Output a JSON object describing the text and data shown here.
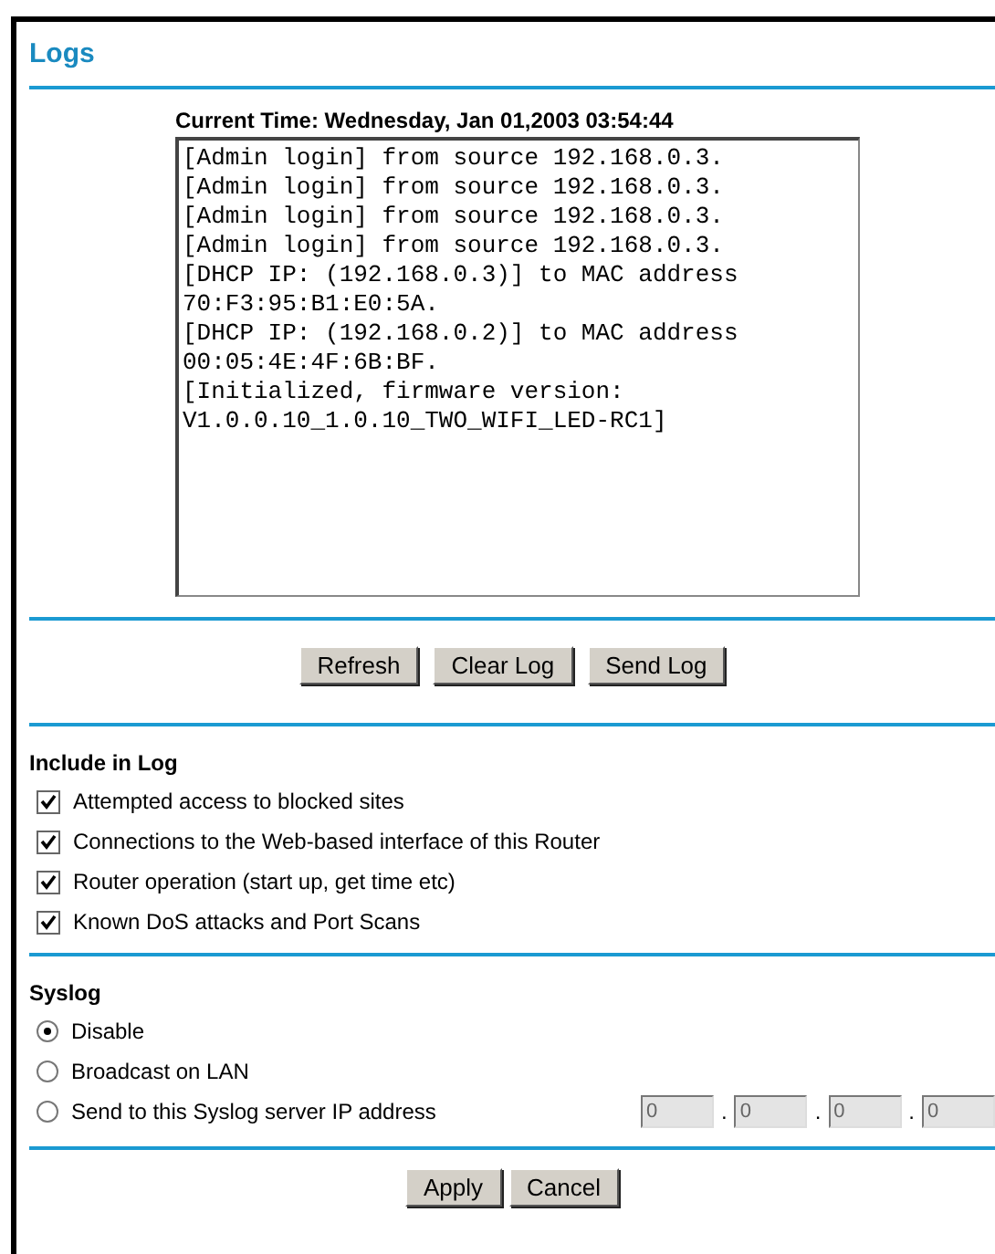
{
  "title": "Logs",
  "current_time": "Current Time: Wednesday, Jan 01,2003 03:54:44",
  "log_lines": [
    "[Admin login] from source 192.168.0.3.",
    "[Admin login] from source 192.168.0.3.",
    "[Admin login] from source 192.168.0.3.",
    "[Admin login] from source 192.168.0.3.",
    "[DHCP IP: (192.168.0.3)] to MAC address",
    "70:F3:95:B1:E0:5A.",
    "[DHCP IP: (192.168.0.2)] to MAC address",
    "00:05:4E:4F:6B:BF.",
    "[Initialized, firmware version:",
    "V1.0.0.10_1.0.10_TWO_WIFI_LED-RC1]"
  ],
  "log_buttons": [
    "Refresh",
    "Clear Log",
    "Send Log"
  ],
  "include_in_log": {
    "heading": "Include in Log",
    "items": [
      {
        "label": "Attempted access to blocked sites",
        "checked": true
      },
      {
        "label": "Connections to the Web-based interface of this Router",
        "checked": true
      },
      {
        "label": "Router operation (start up, get time etc)",
        "checked": true
      },
      {
        "label": "Known DoS attacks and Port Scans",
        "checked": true
      }
    ]
  },
  "syslog": {
    "heading": "Syslog",
    "options": [
      {
        "label": "Disable",
        "selected": true
      },
      {
        "label": "Broadcast on LAN",
        "selected": false
      },
      {
        "label": "Send to this Syslog server IP address",
        "selected": false
      }
    ],
    "ip_fields": {
      "disabled": true,
      "values": [
        "0",
        "0",
        "0",
        "0"
      ],
      "separators": [
        ".",
        ".",
        "."
      ]
    }
  },
  "form_buttons": [
    "Apply",
    "Cancel"
  ]
}
